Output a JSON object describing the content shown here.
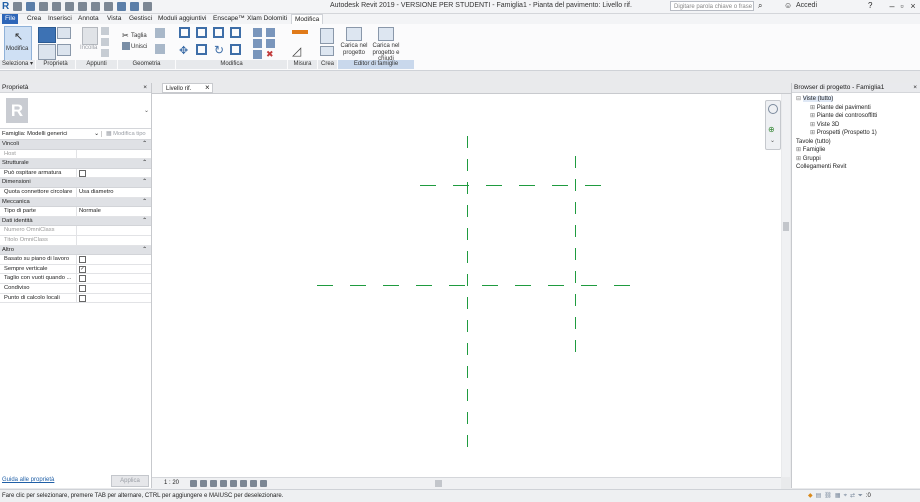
{
  "titlebar": {
    "title": "Autodesk Revit 2019 - VERSIONE PER STUDENTI - Famiglia1 - Pianta del pavimento: Livello rif.",
    "search_placeholder": "Digitare parola chiave o frase",
    "signin": "Accedi"
  },
  "tabs": [
    "File",
    "Crea",
    "Inserisci",
    "Annota",
    "Vista",
    "Gestisci",
    "Moduli aggiuntivi",
    "Enscape™",
    "Xlam Dolomiti",
    "Modifica"
  ],
  "ribbon": {
    "modify_label": "Modifica",
    "panels": [
      "Seleziona ▾",
      "Proprietà",
      "Appunti",
      "Geometria",
      "Modifica",
      "Misura",
      "Crea",
      "Editor di famiglie"
    ],
    "paste_label": "Incolla",
    "cut_label": "Taglia",
    "join_label": "Unisci",
    "load_project_label": "Carica nel progetto",
    "load_close_label": "Carica nel progetto e chiudi"
  },
  "properties": {
    "header": "Proprietà",
    "family_selector": "Famiglia: Modelli generici",
    "edit_type": "Modifica tipo",
    "sections": [
      {
        "name": "Vincoli",
        "rows": [
          {
            "k": "Host",
            "v": "",
            "grey": true
          }
        ]
      },
      {
        "name": "Strutturale",
        "rows": [
          {
            "k": "Può ospitare armatura",
            "v": "",
            "check": false
          }
        ]
      },
      {
        "name": "Dimensioni",
        "rows": [
          {
            "k": "Quota connettore circolare",
            "v": "Usa diametro"
          }
        ]
      },
      {
        "name": "Meccanica",
        "rows": [
          {
            "k": "Tipo di parte",
            "v": "Normale"
          }
        ]
      },
      {
        "name": "Dati identità",
        "rows": [
          {
            "k": "Numero OmniClass",
            "v": "",
            "grey": true
          },
          {
            "k": "Titolo OmniClass",
            "v": "",
            "grey": true
          }
        ]
      },
      {
        "name": "Altro",
        "rows": [
          {
            "k": "Basato su piano di lavoro",
            "v": "",
            "check": false
          },
          {
            "k": "Sempre verticale",
            "v": "",
            "check": true
          },
          {
            "k": "Taglio con vuoti quando ...",
            "v": "",
            "check": false
          },
          {
            "k": "Condiviso",
            "v": "",
            "check": false
          },
          {
            "k": "Punto di calcolo locali",
            "v": "",
            "check": false
          }
        ]
      }
    ],
    "help_link": "Guida alle proprietà",
    "apply_button": "Applica"
  },
  "view": {
    "tab_label": "Livello rif.",
    "scale": "1 : 20",
    "reference_line_color": "#1f9b3f"
  },
  "browser": {
    "header": "Browser di progetto - Famiglia1",
    "items": [
      {
        "label": "Viste (tutto)",
        "level": 0
      },
      {
        "label": "Piante dei pavimenti",
        "level": 1
      },
      {
        "label": "Piante dei controsoffitti",
        "level": 1
      },
      {
        "label": "Viste 3D",
        "level": 1
      },
      {
        "label": "Prospetti (Prospetto 1)",
        "level": 1
      },
      {
        "label": "Tavole (tutto)",
        "level": 0
      },
      {
        "label": "Famiglie",
        "level": 0
      },
      {
        "label": "Gruppi",
        "level": 0
      },
      {
        "label": "Collegamenti Revit",
        "level": 0
      }
    ]
  },
  "status": {
    "message": "Fare clic per selezionare, premere TAB per alternare, CTRL per aggiungere e MAIUSC per deselezionare.",
    "filter_count": ":0"
  }
}
